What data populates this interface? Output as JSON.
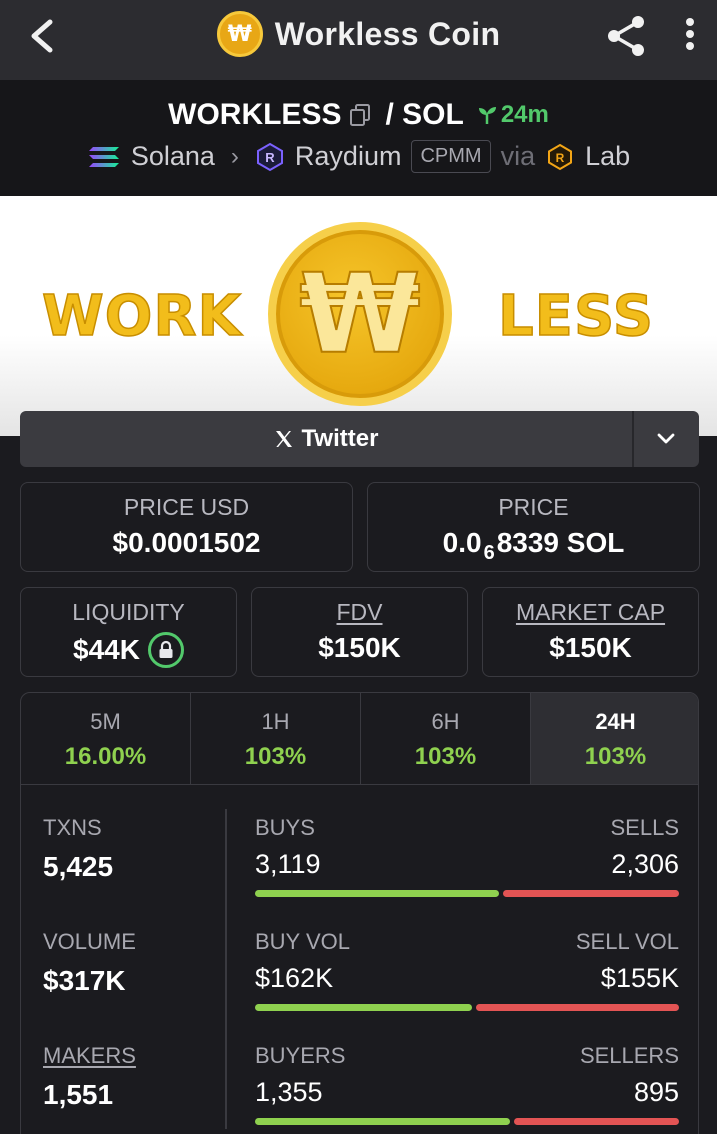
{
  "header": {
    "title": "Workless Coin",
    "coin_symbol": "₩",
    "icons": [
      "back-arrow-icon",
      "share-icon",
      "more-vertical-icon"
    ]
  },
  "pair": {
    "base": "WORKLESS",
    "quote": "/ SOL",
    "age": "24m",
    "chain": "Solana",
    "dex": "Raydium",
    "pool_type": "CPMM",
    "via": "via",
    "launchpad": "Lab"
  },
  "banner": {
    "left_text": "WORK",
    "right_text": "LESS",
    "coin_symbol": "₩"
  },
  "socials": {
    "twitter_label": "Twitter"
  },
  "prices": {
    "usd_label": "PRICE USD",
    "usd_value": "$0.0001502",
    "native_label": "PRICE",
    "native_prefix": "0.0",
    "native_zeros": "6",
    "native_suffix": "8339 SOL"
  },
  "metrics": {
    "liquidity_label": "LIQUIDITY",
    "liquidity_value": "$44K",
    "fdv_label": "FDV",
    "fdv_value": "$150K",
    "mcap_label": "MARKET CAP",
    "mcap_value": "$150K"
  },
  "timeframes": [
    {
      "label": "5M",
      "change": "16.00%"
    },
    {
      "label": "1H",
      "change": "103%"
    },
    {
      "label": "6H",
      "change": "103%"
    },
    {
      "label": "24H",
      "change": "103%"
    }
  ],
  "activity": {
    "txns_label": "TXNS",
    "txns_value": "5,425",
    "buys_label": "BUYS",
    "buys_value": "3,119",
    "sells_label": "SELLS",
    "sells_value": "2,306",
    "buys_fraction": 0.575,
    "volume_label": "VOLUME",
    "volume_value": "$317K",
    "buyvol_label": "BUY VOL",
    "buyvol_value": "$162K",
    "sellvol_label": "SELL VOL",
    "sellvol_value": "$155K",
    "buyvol_fraction": 0.511,
    "makers_label": "MAKERS",
    "makers_value": "1,551",
    "buyers_label": "BUYERS",
    "buyers_value": "1,355",
    "sellers_label": "SELLERS",
    "sellers_value": "895",
    "buyers_fraction": 0.602
  },
  "colors": {
    "positive": "#8fd14f",
    "negative": "#e35454",
    "accent_green": "#52c96b",
    "coin_gold": "#f2bd1b"
  }
}
